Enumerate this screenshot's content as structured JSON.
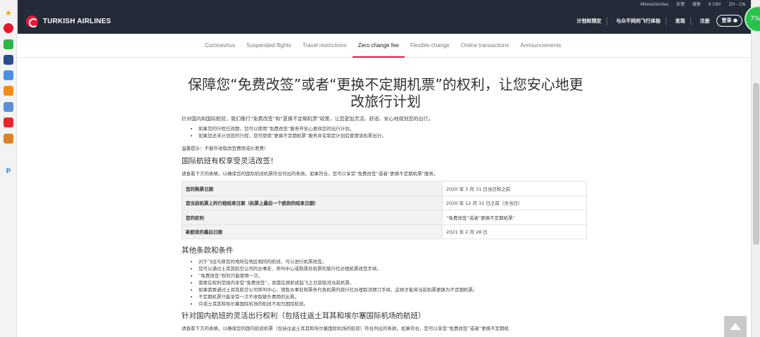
{
  "utility_bar": {
    "items": [
      "Miles&Smiles",
      "反馈",
      "搜索",
      "¥ CNY",
      "ZH - CN"
    ]
  },
  "header": {
    "brand": "TURKISH AIRLINES",
    "nav": [
      "计划和预定",
      "与众不同的飞行体验",
      "发现",
      "注册"
    ],
    "login": "登录"
  },
  "tabs": [
    {
      "label": "Coronavirus",
      "active": false
    },
    {
      "label": "Suspended flights",
      "active": false
    },
    {
      "label": "Travel restrictions",
      "active": false
    },
    {
      "label": "Zero change fee",
      "active": true
    },
    {
      "label": "Flexible change",
      "active": false
    },
    {
      "label": "Online transactions",
      "active": false
    },
    {
      "label": "Announcements",
      "active": false
    }
  ],
  "main": {
    "title": "保障您“免费改签”或者“更换不定期机票”的权利，让您安心地更改旅行计划",
    "intro": "针对国内和国际航班，我们推行“免费改签”和“更换不定期机票”政策，让您更加灵活、舒适、安心地规划您的出行。",
    "bullets": [
      "如果您的行程已改期，您可以使用“免费改签”服务开安心更改您的出行计划。",
      "如果您还未计划您的行程，您可使用“更换不定期机票”服务并在制定计划后使用该机票出行。"
    ],
    "note": "温馨提示：不额外收取改签费用或价差费！",
    "section1_title": "国际航班有权享受灵活改签！",
    "section1_desc": "请查看下方的表格，以确保您的国际航班机票符合列出的条款。如果符合，您可以享受“免费改签”或者“更换不定期机票”服务。",
    "table": [
      {
        "key": "您的购票日期",
        "value": "2020 年 3 月 31 日当日和之前"
      },
      {
        "key": "您当前机票上的行程结束日期（机票上最后一个航段的结束日期）",
        "value": "2020 年 12 月 31 日之前（含当日）"
      },
      {
        "key": "您的权利",
        "value": "“免费改签”或者“更换不定期机票”"
      },
      {
        "key": "新航班的最后日期",
        "value": "2021 年 2 月 28 日"
      }
    ],
    "section2_title": "其他条款和条件",
    "terms": [
      "对于飞往与原目的地所在地区相同的航班，可以进行机票改签。",
      "您可以通过土耳其航空公司的办事处、呼叫中心或购票处机票的旅行社办理机票改签手续。",
      "“免费改签”权利只能使用一次。",
      "需要在权利范围内享受“免费改签”，则需在原航班起飞之日前取消当前机票。",
      "如果需要通过土耳其航空公司呼叫中心、销售办事处和票务代表机票的旅行社办理取消预订手续，这样才能将当前机票更换为不定期机票。",
      "不定期机票只能享受一次不收取额外费用的出票。",
      "许诺土耳其和埃尔塞国际机场的航班不视为国际航班。"
    ],
    "section3_title": "针对国内航班的灵活出行权利（包括往返土耳其和埃尔塞国际机场的航班）",
    "section3_desc": "请查看下方的表格，以确保您的国内航班机票（包括往返土耳其和埃尔塞国际机场的航班）符合列出的条款。如果符合，您可以享受“免费改签”或者“更换不定期机"
  },
  "badge": "7%",
  "colors": {
    "header_bg": "#232b38",
    "brand_red": "#e81932",
    "active_tab_underline": "#e81932"
  }
}
